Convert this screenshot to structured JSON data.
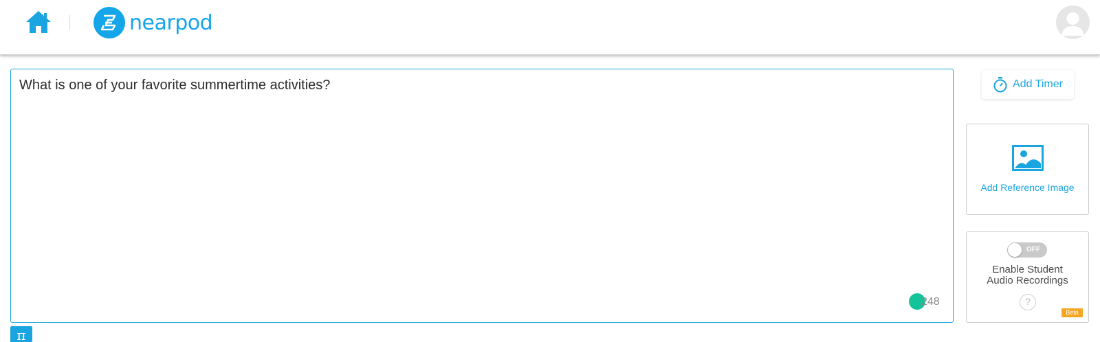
{
  "header": {
    "brand_name": "nearpod",
    "brand_color": "#14a6e8"
  },
  "question": {
    "text": "What is one of your favorite summertime activities?",
    "char_count": "248"
  },
  "toolbar": {
    "math_symbol": "π"
  },
  "sidebar": {
    "timer_label": "Add Timer",
    "reference_image_label": "Add Reference Image",
    "audio_toggle_state": "OFF",
    "audio_label_line1": "Enable Student",
    "audio_label_line2": "Audio Recordings",
    "help_symbol": "?",
    "beta_label": "Beta"
  },
  "colors": {
    "accent": "#1aa5e0",
    "beta": "#f5a623",
    "grammarly": "#15c39a"
  },
  "icons": [
    "home-icon",
    "nearpod-logo-icon",
    "avatar-icon",
    "stopwatch-icon",
    "image-icon",
    "help-icon"
  ]
}
